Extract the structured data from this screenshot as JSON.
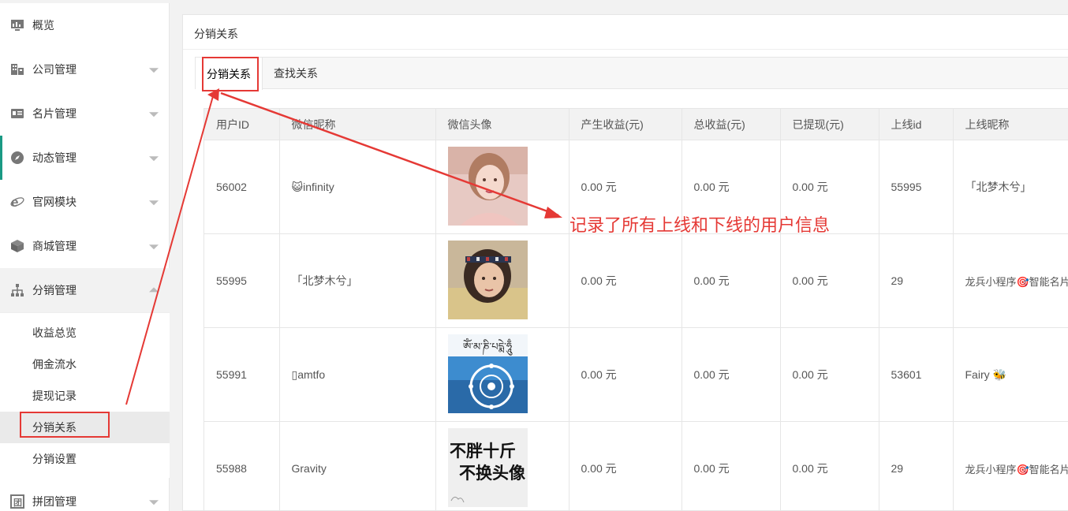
{
  "sidebar": {
    "items": [
      {
        "label": "概览",
        "icon": "monitor-icon",
        "has_arrow": false
      },
      {
        "label": "公司管理",
        "icon": "building-icon",
        "has_arrow": true
      },
      {
        "label": "名片管理",
        "icon": "card-icon",
        "has_arrow": true
      },
      {
        "label": "动态管理",
        "icon": "compass-icon",
        "has_arrow": true
      },
      {
        "label": "官网模块",
        "icon": "ie-icon",
        "has_arrow": true
      },
      {
        "label": "商城管理",
        "icon": "box-icon",
        "has_arrow": true
      },
      {
        "label": "分销管理",
        "icon": "hierarchy-icon",
        "has_arrow": true
      },
      {
        "label": "拼团管理",
        "icon": "group-icon",
        "has_arrow": true
      }
    ],
    "submenu": [
      "收益总览",
      "佣金流水",
      "提现记录",
      "分销关系",
      "分销设置"
    ],
    "active_submenu": "分销关系"
  },
  "main": {
    "page_title": "分销关系",
    "tabs": [
      {
        "label": "分销关系",
        "active": true
      },
      {
        "label": "查找关系",
        "active": false
      }
    ]
  },
  "table": {
    "columns": [
      "用户ID",
      "微信昵称",
      "微信头像",
      "产生收益(元)",
      "总收益(元)",
      "已提现(元)",
      "上线id",
      "上线昵称"
    ],
    "rows": [
      {
        "user_id": "56002",
        "nickname": "😺infinity",
        "avatar": "woman-portrait-1",
        "produced": "0.00 元",
        "total": "0.00 元",
        "withdrawn": "0.00 元",
        "upline_id": "55995",
        "upline_nickname": "「北梦木兮」"
      },
      {
        "user_id": "55995",
        "nickname": "「北梦木兮」",
        "avatar": "woman-portrait-2",
        "produced": "0.00 元",
        "total": "0.00 元",
        "withdrawn": "0.00 元",
        "upline_id": "29",
        "upline_nickname": "龙兵小程序🎯智能名片"
      },
      {
        "user_id": "55991",
        "nickname": "▯amtfo",
        "avatar": "tibetan-mandala",
        "produced": "0.00 元",
        "total": "0.00 元",
        "withdrawn": "0.00 元",
        "upline_id": "53601",
        "upline_nickname": "Fairy 🐝"
      },
      {
        "user_id": "55988",
        "nickname": "Gravity",
        "avatar": "text-avatar",
        "produced": "0.00 元",
        "total": "0.00 元",
        "withdrawn": "0.00 元",
        "upline_id": "29",
        "upline_nickname": "龙兵小程序🎯智能名片"
      }
    ],
    "text_avatar_lines": [
      "不胖十斤",
      "不换头像"
    ],
    "tibetan_text": "ཨོཾ་མ་ཎི་པདྨེ་ཧཱུྃ"
  },
  "annotation": {
    "text": "记录了所有上线和下线的用户信息",
    "color": "#e53935"
  },
  "colors": {
    "accent_green": "#1a9a84",
    "annotation_red": "#e53935"
  }
}
